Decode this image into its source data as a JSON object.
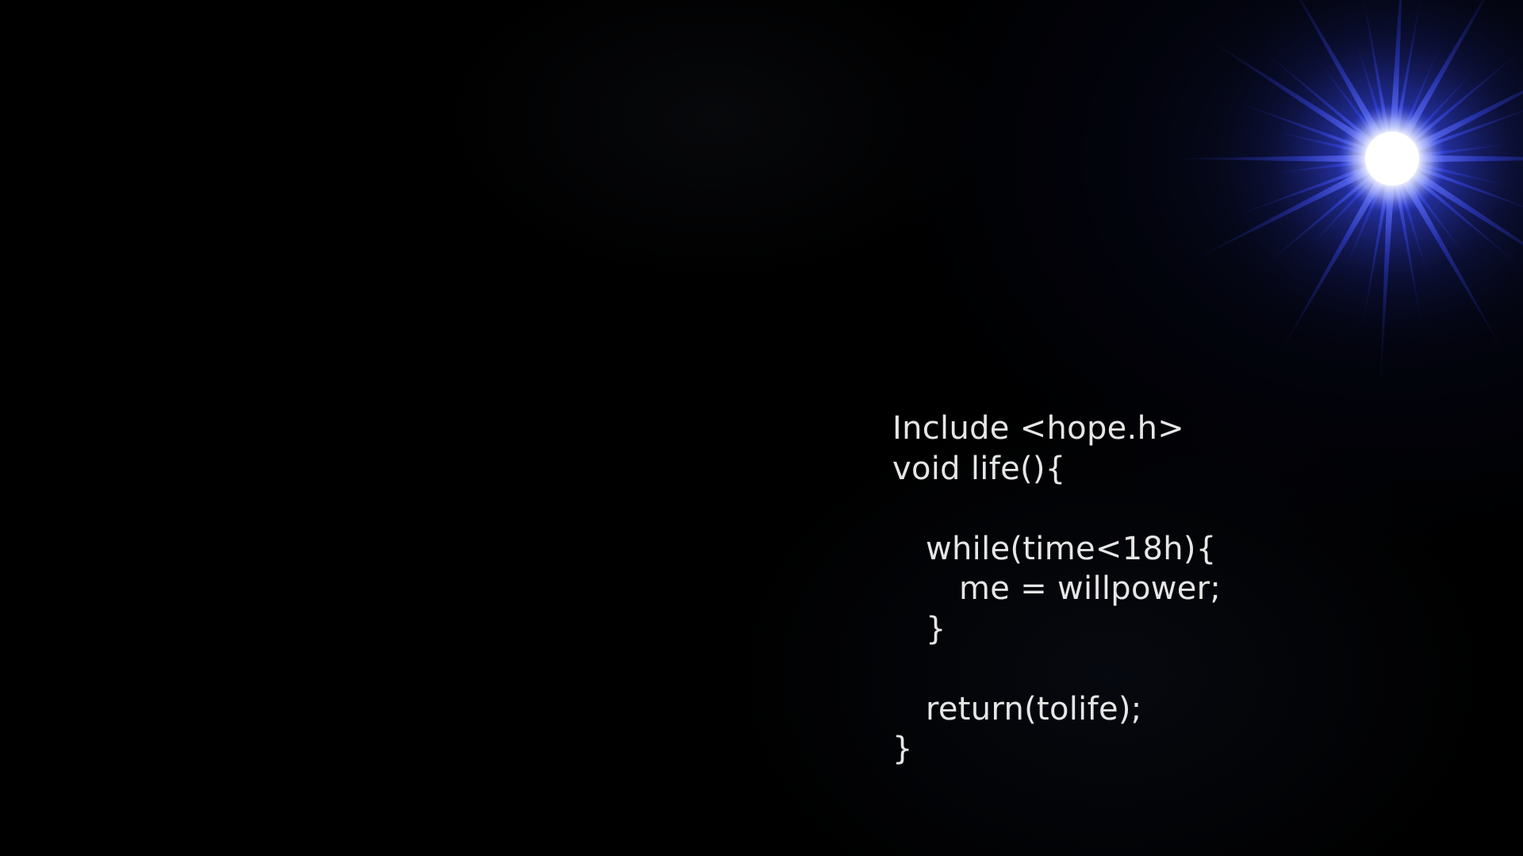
{
  "wallpaper": {
    "background_color": "#000000",
    "flare_color": "#3a4cff",
    "text_color": "#e6e6e6",
    "icon": "star-flare-icon"
  },
  "code": {
    "lines": [
      {
        "text": "Include <hope.h>",
        "indent": 0
      },
      {
        "text": "void life(){",
        "indent": 0
      },
      {
        "text": "",
        "indent": 0
      },
      {
        "text": "while(time<18h){",
        "indent": 1
      },
      {
        "text": "me = willpower;",
        "indent": 2
      },
      {
        "text": "}",
        "indent": 1
      },
      {
        "text": "",
        "indent": 0
      },
      {
        "text": "return(tolife);",
        "indent": 1
      },
      {
        "text": "}",
        "indent": 0
      }
    ]
  }
}
